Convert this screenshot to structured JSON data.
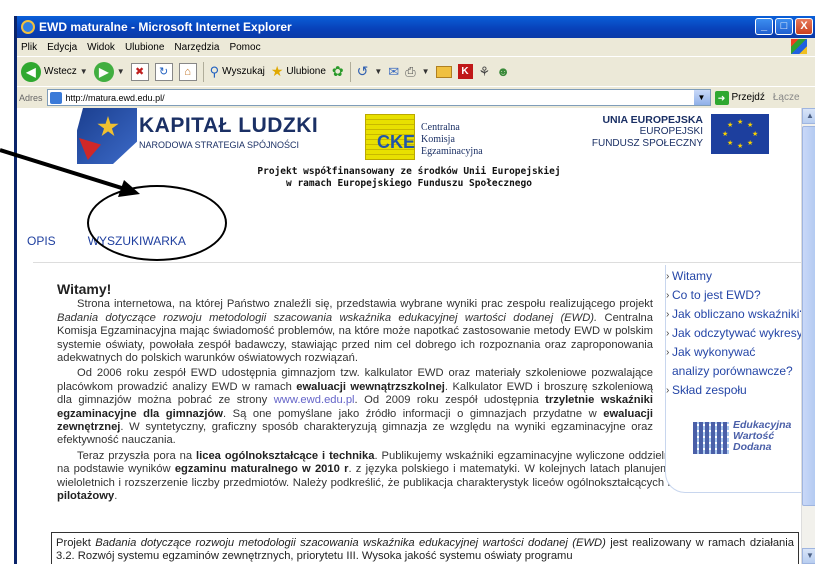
{
  "window": {
    "title": "EWD maturalne - Microsoft Internet Explorer",
    "controls": [
      "_",
      "□",
      "X"
    ]
  },
  "menubar": [
    "Plik",
    "Edycja",
    "Widok",
    "Ulubione",
    "Narzędzia",
    "Pomoc"
  ],
  "toolbar": {
    "back": "Wstecz",
    "search": "Wyszukaj",
    "favorites": "Ulubione"
  },
  "address": {
    "label": "Adres",
    "url": "http://matura.ewd.edu.pl/",
    "go": "Przejdź",
    "links": "Łącze"
  },
  "banner": {
    "kl_title": "KAPITAŁ LUDZKI",
    "kl_subtitle": "NARODOWA STRATEGIA SPÓJNOŚCI",
    "cke_abbr": "CKE",
    "cke_name": [
      "Centralna",
      "Komisja",
      "Egzaminacyjna"
    ],
    "ue_lines": [
      "UNIA EUROPEJSKA",
      "EUROPEJSKI",
      "FUNDUSZ SPOŁECZNY"
    ]
  },
  "cofinancing": [
    "Projekt współfinansowany ze środków Unii Europejskiej",
    "w ramach Europejskiego Funduszu Społecznego"
  ],
  "nav": [
    "OPIS",
    "WYSZUKIWARKA"
  ],
  "main": {
    "heading": "Witamy!",
    "p1_a": "Strona internetowa, na której Państwo znaleźli się, przedstawia wybrane wyniki prac zespołu realizującego projekt ",
    "p1_i": "Badania dotyczące rozwoju metodologii szacowania wskaźnika edukacyjnej wartości dodanej (EWD).",
    "p1_b": " Centralna Komisja Egzaminacyjna mając świadomość problemów, na które może napotkać zastosowanie metody EWD w polskim systemie oświaty, powołała zespół badawczy, stawiając przed nim cel dobrego ich rozpoznania oraz zaproponowania adekwatnych do polskich warunków oświatowych rozwiązań.",
    "p2_a": "Od 2006 roku zespół EWD udostępnia gimnazjom tzw. kalkulator EWD oraz materiały szkoleniowe pozwalające placówkom prowadzić analizy EWD w ramach ",
    "p2_b1": "ewaluacji wewnątrzszkolnej",
    "p2_c": ". Kalkulator EWD i broszurę szkoleniową dla gimnazjów można pobrać ze strony ",
    "p2_link": "www.ewd.edu.pl",
    "p2_d": ". Od 2009 roku zespół udostępnia ",
    "p2_b2": "trzyletnie wskaźniki egzaminacyjne dla gimnazjów",
    "p2_e": ". Są one pomyślane jako źródło informacji o gimnazjach przydatne w ",
    "p2_b3": "ewaluacji zewnętrznej",
    "p2_f": ". W syntetyczny, graficzny sposób charakteryzują gimnazja ze względu na wyniki egzaminacyjne oraz efektywność nauczania.",
    "p3_a": "Teraz przyszła pora na ",
    "p3_b1": "licea ogólnokształcące i technika",
    "p3_c": ". Publikujemy wskaźniki egzaminacyjne wyliczone oddzielnie dla liceów i techników na podstawie wyników ",
    "p3_b2": "egzaminu maturalnego w 2010 r",
    "p3_d": ". z języka polskiego i matematyki. W kolejnych latach planujemy publikację wskaźników wieloletnich i rozszerzenie liczby przedmiotów. Należy podkreślić, że publikacja charakterystyk liceów ogólnokształcących i techników ma charakter ",
    "p3_b3": "pilotażowy",
    "p3_e": "."
  },
  "sidebar": {
    "links": [
      "Witamy",
      "Co to jest EWD?",
      "Jak obliczano wskaźniki?",
      "Jak odczytywać wykresy?",
      "Jak wykonywać",
      "analizy porównawcze?",
      "Skład zespołu"
    ],
    "ewd_logo": [
      "Edukacyjna",
      "Wartość",
      "Dodana"
    ]
  },
  "bottom_box": {
    "a": "Projekt ",
    "i": "Badania dotyczące rozwoju metodologii szacowania wskaźnika edukacyjnej wartości dodanej (EWD)",
    "b": " jest realizowany w ramach działania 3.2. Rozwój systemu egzaminów zewnętrznych, priorytetu III. Wysoka jakość systemu oświaty programu"
  }
}
